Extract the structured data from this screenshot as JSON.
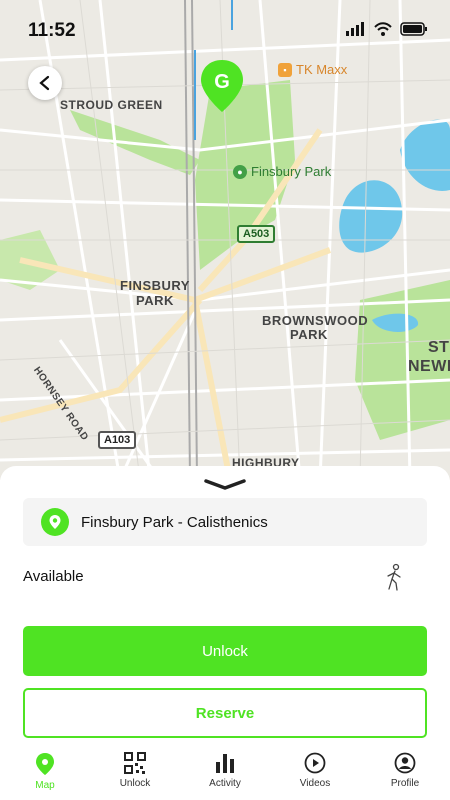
{
  "status": {
    "time": "11:52"
  },
  "map": {
    "labels": {
      "stroud_green": "STROUD GREEN",
      "finsbury_park_area_1": "FINSBURY",
      "finsbury_park_area_2": "PARK",
      "brownswood_1": "BROWNSWOOD",
      "brownswood_2": "PARK",
      "stoke_1": "ST",
      "stoke_2": "NEWI",
      "hornsey_road": "HORNSEY ROAD",
      "highbury": "HIGHBURY"
    },
    "pois": {
      "tk_maxx": "TK Maxx",
      "finsbury_park": "Finsbury Park"
    },
    "roads": {
      "a503": "A503",
      "a103": "A103"
    },
    "pin_letter": "G"
  },
  "sheet": {
    "location_name": "Finsbury Park - Calisthenics",
    "availability": "Available",
    "unlock_label": "Unlock",
    "reserve_label": "Reserve"
  },
  "tabs": [
    {
      "label": "Map",
      "icon": "map-pin-icon"
    },
    {
      "label": "Unlock",
      "icon": "qr-code-icon"
    },
    {
      "label": "Activity",
      "icon": "bar-chart-icon"
    },
    {
      "label": "Videos",
      "icon": "play-circle-icon"
    },
    {
      "label": "Profile",
      "icon": "user-circle-icon"
    }
  ],
  "colors": {
    "accent": "#4fe323",
    "park": "#b9e39a",
    "water": "#6fc7ea",
    "road": "#ffffff"
  }
}
